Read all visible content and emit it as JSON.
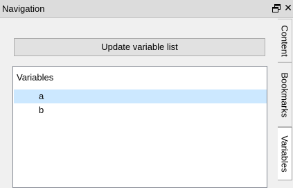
{
  "panel": {
    "title": "Navigation"
  },
  "controls": {
    "float_icon": "float-window-icon",
    "close_glyph": "✕"
  },
  "main": {
    "update_button_label": "Update variable list",
    "tree": {
      "header": "Variables",
      "items": [
        {
          "label": "a",
          "selected": true
        },
        {
          "label": "b",
          "selected": false
        }
      ]
    }
  },
  "tabs": [
    {
      "label": "Content",
      "active": false
    },
    {
      "label": "Bookmarks",
      "active": false
    },
    {
      "label": "Variables",
      "active": true
    }
  ],
  "colors": {
    "selection": "#cce8ff",
    "titlebar": "#dcdcdc",
    "panel_bg": "#f0f0f0"
  }
}
